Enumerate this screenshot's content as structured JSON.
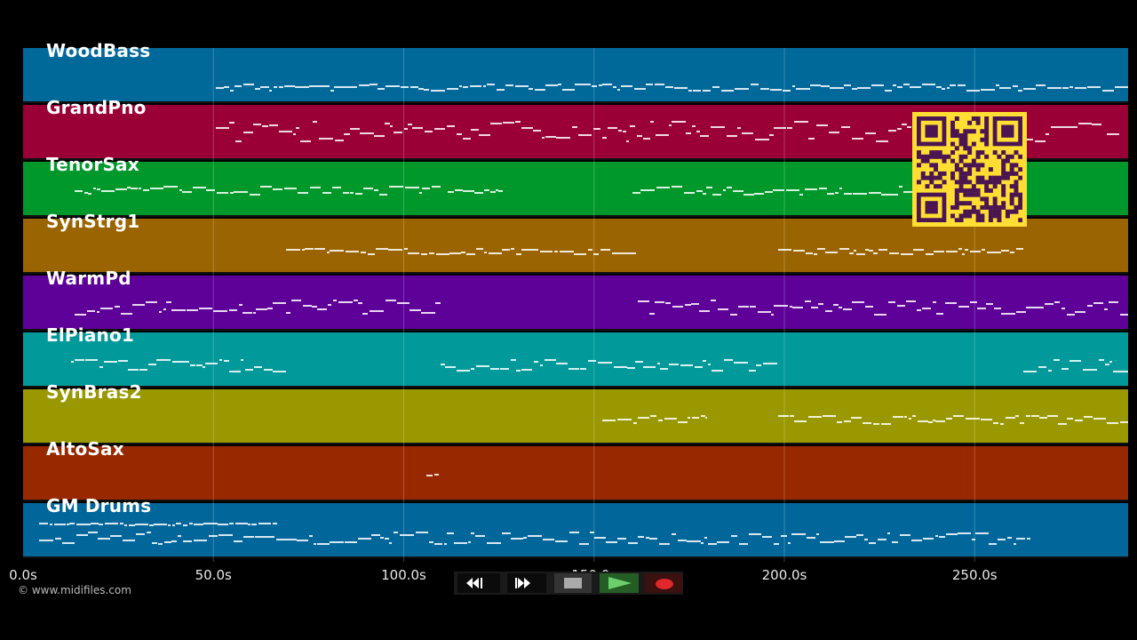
{
  "tracks": [
    {
      "name": "WoodBass",
      "color": "#01689a"
    },
    {
      "name": "GrandPno",
      "color": "#9a0035"
    },
    {
      "name": "TenorSax",
      "color": "#01982b"
    },
    {
      "name": "SynStrg1",
      "color": "#9a6401"
    },
    {
      "name": "WarmPd",
      "color": "#5d0198"
    },
    {
      "name": "ElPiano1",
      "color": "#019999"
    },
    {
      "name": "SynBras2",
      "color": "#999801"
    },
    {
      "name": "AltoSax",
      "color": "#982800"
    },
    {
      "name": "GM Drums",
      "color": "#01679a"
    }
  ],
  "timeline": {
    "ticks": [
      {
        "label": "0.0s",
        "seconds": 0
      },
      {
        "label": "50.0s",
        "seconds": 50
      },
      {
        "label": "100.0s",
        "seconds": 100
      },
      {
        "label": "150.0s",
        "seconds": 150
      },
      {
        "label": "200.0s",
        "seconds": 200
      },
      {
        "label": "250.0s",
        "seconds": 250
      }
    ],
    "duration_seconds": 290
  },
  "copyright": "© www.midifiles.com",
  "transport": {
    "buttons": [
      {
        "name": "rewind-button",
        "icon": "rewind-icon"
      },
      {
        "name": "fast-forward-button",
        "icon": "fast-forward-icon"
      },
      {
        "name": "stop-button",
        "icon": "stop-icon"
      },
      {
        "name": "play-button",
        "icon": "play-icon"
      },
      {
        "name": "record-button",
        "icon": "record-icon"
      }
    ]
  },
  "colors": {
    "accent_qr": "#ffdd33",
    "qr_dark": "#4a1550",
    "background": "#000000"
  }
}
